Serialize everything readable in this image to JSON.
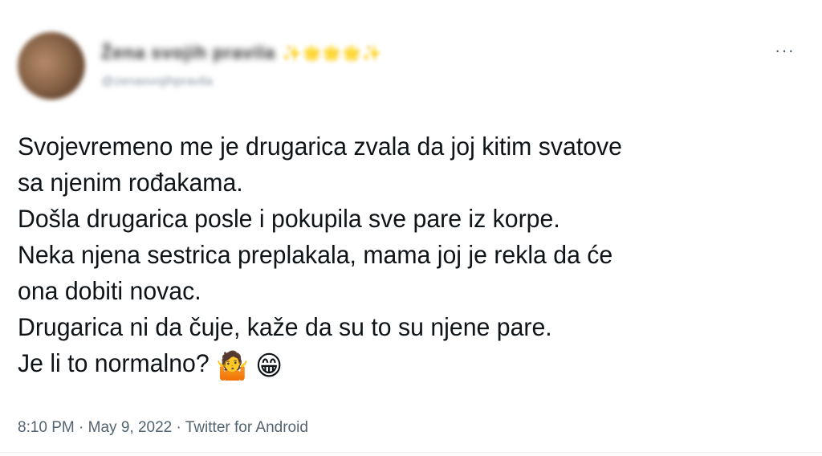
{
  "author": {
    "display_name": "Žena svojih pravila",
    "badge_emojis": "✨🌟🌟🌟✨",
    "handle": "@zenasvojihpravila"
  },
  "more_icon": "more-horizontal-icon",
  "tweet": {
    "lines": [
      "Svojevremeno me je drugarica zvala da joj kitim svatove",
      "sa njenim rođakama.",
      "Došla drugarica posle i pokupila sve pare iz korpe.",
      "Neka njena sestrica preplakala, mama joj je rekla da će",
      "ona dobiti novac.",
      "Drugarica ni da čuje, kaže da su to su njene pare.",
      "Je li to normalno?"
    ],
    "emojis": [
      "🤷",
      "😁"
    ]
  },
  "meta": {
    "time": "8:10 PM",
    "sep1": " · ",
    "date": "May 9, 2022",
    "sep2": " · ",
    "source": "Twitter for Android"
  }
}
